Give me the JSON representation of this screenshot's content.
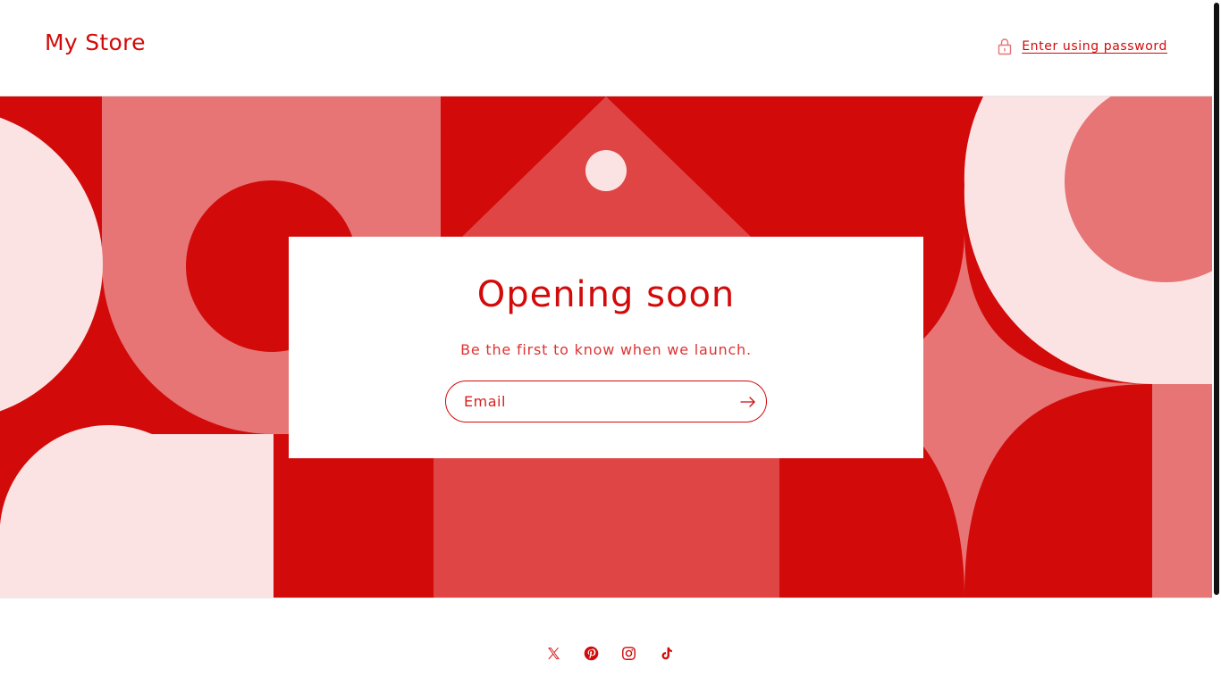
{
  "header": {
    "store_name": "My Store",
    "enter_password_label": "Enter using password",
    "lock_icon": "lock-icon"
  },
  "card": {
    "title": "Opening soon",
    "subtitle": "Be the first to know when we launch.",
    "email_value": "",
    "email_placeholder": "Email",
    "submit_icon": "arrow-right-icon"
  },
  "footer": {
    "socials": [
      {
        "name": "X (Twitter)",
        "icon": "x-twitter-icon"
      },
      {
        "name": "Pinterest",
        "icon": "pinterest-icon"
      },
      {
        "name": "Instagram",
        "icon": "instagram-icon"
      },
      {
        "name": "TikTok",
        "icon": "tiktok-icon"
      }
    ]
  },
  "colors": {
    "brand": "#d20a0a",
    "red_dark": "#d20a0a",
    "red_mid": "#e04545",
    "red_soft": "#e77575",
    "pink_light": "#fbe3e3",
    "background": "#ffffff"
  }
}
